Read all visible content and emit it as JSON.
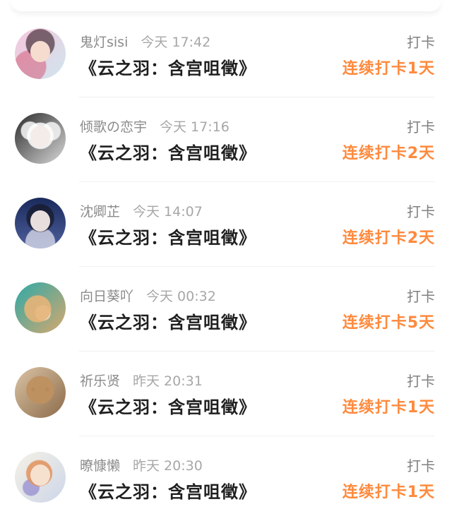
{
  "app": {
    "accent": "#FF8A3D"
  },
  "entries": [
    {
      "username": "鬼灯sisi",
      "time": "今天 17:42",
      "book_title": "《云之羽：含宫咀徵》",
      "action_label": "打卡",
      "streak_label": "连续打卡1天",
      "avatar_icon": "anime-avatar-icon"
    },
    {
      "username": "倾歌の恋宇",
      "time": "今天 17:16",
      "book_title": "《云之羽：含宫咀徵》",
      "action_label": "打卡",
      "streak_label": "连续打卡2天",
      "avatar_icon": "anime-avatar-icon"
    },
    {
      "username": "沈卿芷",
      "time": "今天 14:07",
      "book_title": "《云之羽：含宫咀徵》",
      "action_label": "打卡",
      "streak_label": "连续打卡2天",
      "avatar_icon": "portrait-avatar-icon"
    },
    {
      "username": "向日葵吖",
      "time": "今天 00:32",
      "book_title": "《云之羽：含宫咀徵》",
      "action_label": "打卡",
      "streak_label": "连续打卡5天",
      "avatar_icon": "dog-avatar-icon"
    },
    {
      "username": "祈乐贤",
      "time": "昨天 20:31",
      "book_title": "《云之羽：含宫咀徵》",
      "action_label": "打卡",
      "streak_label": "连续打卡1天",
      "avatar_icon": "bear-avatar-icon"
    },
    {
      "username": "暸慷懒",
      "time": "昨天 20:30",
      "book_title": "《云之羽：含宫咀徵》",
      "action_label": "打卡",
      "streak_label": "连续打卡1天",
      "avatar_icon": "illustration-avatar-icon"
    }
  ]
}
